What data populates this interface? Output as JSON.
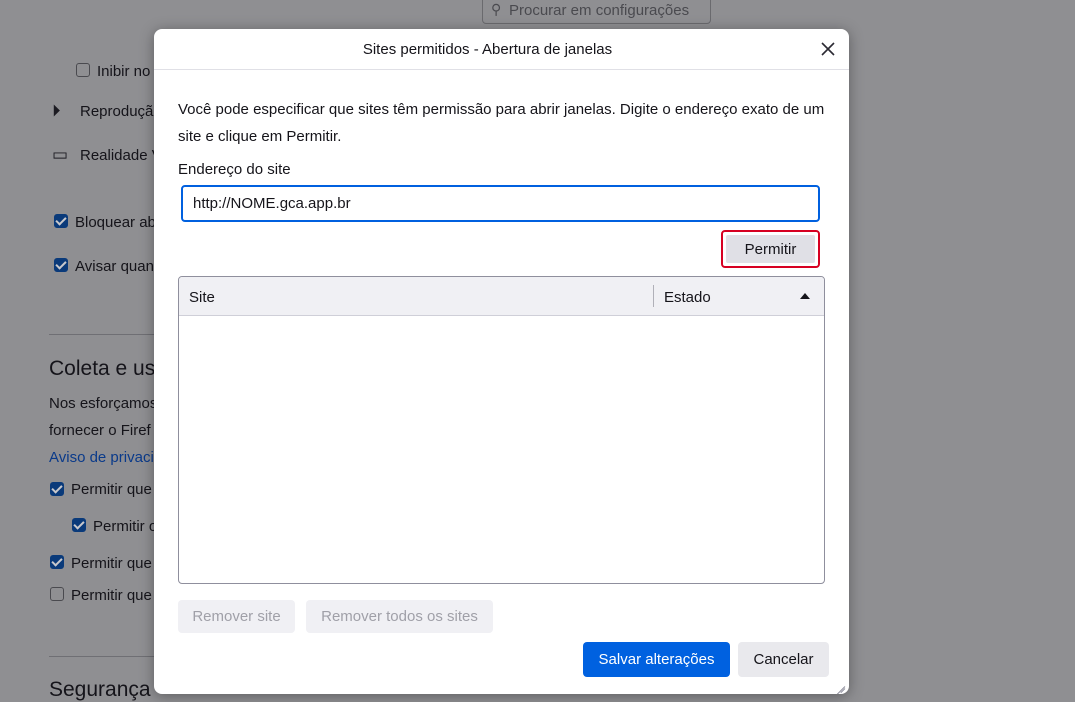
{
  "background": {
    "search_placeholder": "Procurar em configurações",
    "rows": [
      {
        "label": "Inibir no",
        "checked": false
      },
      {
        "label": "Reproduçã"
      },
      {
        "label": "Realidade V"
      },
      {
        "label": "Bloquear ab",
        "checked": true
      },
      {
        "label": "Avisar quan",
        "checked": true
      }
    ],
    "section_data_heading": "Coleta e uso",
    "section_data_text_1": "Nos esforçamos",
    "section_data_text_2": "fornecer o Firef",
    "privacy_link": "Aviso de privaci",
    "data_rows": [
      {
        "label": "Permitir que",
        "checked": true
      },
      {
        "label": "Permitir o",
        "checked": true
      },
      {
        "label": "Permitir que",
        "checked": true
      },
      {
        "label": "Permitir que",
        "checked": false
      }
    ],
    "section_security_heading": "Segurança"
  },
  "dialog": {
    "title": "Sites permitidos - Abertura de janelas",
    "description": "Você pode especificar que sites têm permissão para abrir janelas. Digite o endereço exato de um site e clique em Permitir.",
    "address_label": "Endereço do site",
    "address_value": "http://NOME.gca.app.br",
    "allow_button": "Permitir",
    "table": {
      "columns": [
        "Site",
        "Estado"
      ],
      "rows": []
    },
    "remove_site_button": "Remover site",
    "remove_all_button": "Remover todos os sites",
    "save_button": "Salvar alterações",
    "cancel_button": "Cancelar"
  },
  "colors": {
    "accent": "#0061e0",
    "highlight_border": "#d70022"
  }
}
